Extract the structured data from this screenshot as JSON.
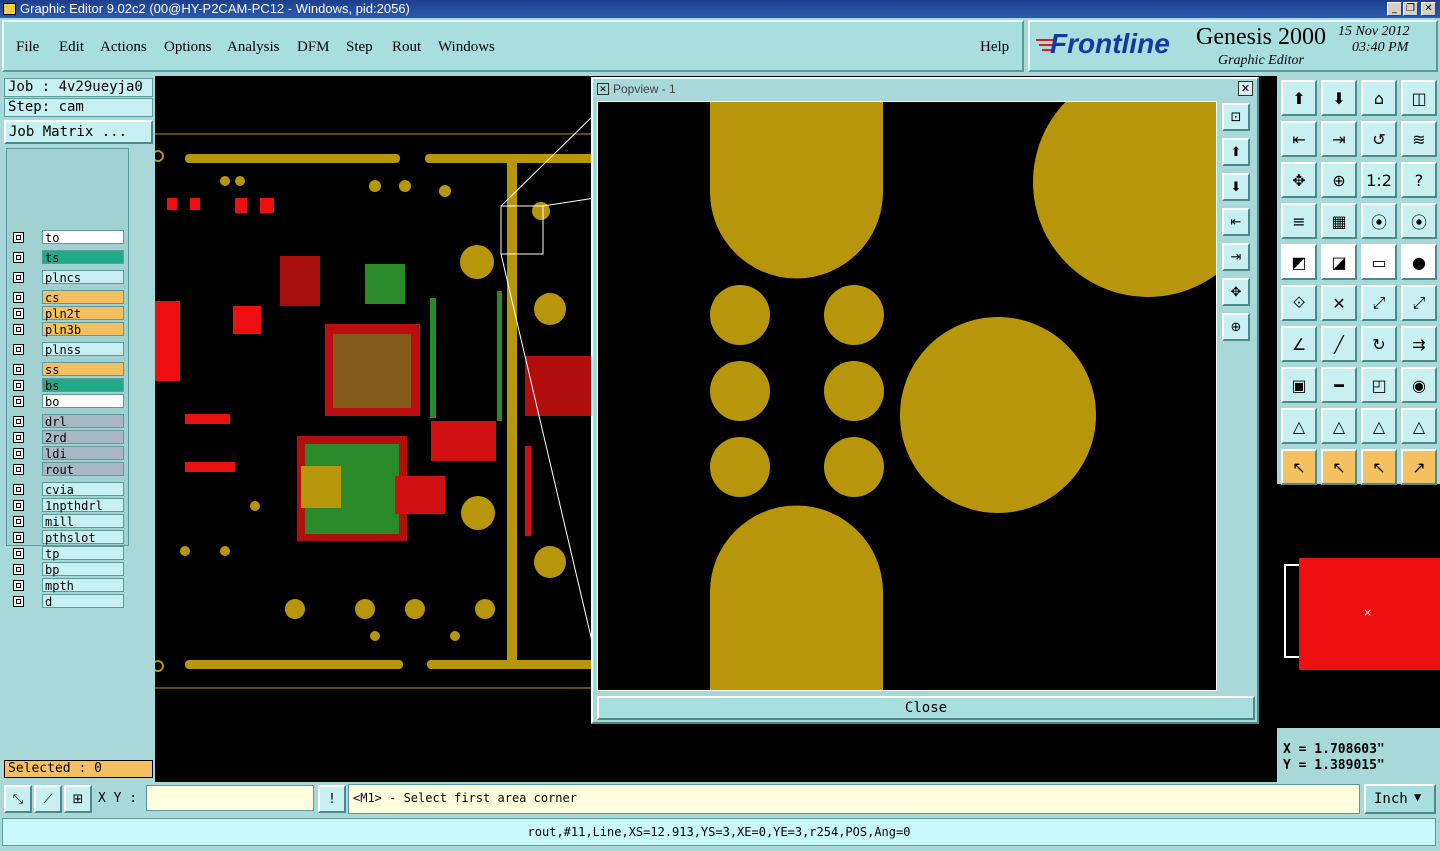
{
  "window": {
    "title": "Graphic Editor 9.02c2 (00@HY-P2CAM-PC12 - Windows, pid:2056)"
  },
  "menu": {
    "items": [
      "File",
      "Edit",
      "Actions",
      "Options",
      "Analysis",
      "DFM",
      "Step",
      "Rout",
      "Windows"
    ],
    "help": "Help"
  },
  "brand": {
    "logo": "Frontline",
    "product": "Genesis 2000",
    "subtitle": "Graphic Editor",
    "date": "15 Nov 2012",
    "time": "03:40 PM"
  },
  "job": {
    "job": "Job : 4v29ueyja0",
    "step": "Step: cam",
    "matrix_button": "Job Matrix ..."
  },
  "layers": [
    {
      "name": "to",
      "color": "#ffffff"
    },
    {
      "name": "ts",
      "color": "#22aa88"
    },
    {
      "name": "plncs",
      "color": "#c8f0f0"
    },
    {
      "name": "cs",
      "color": "#f5c060"
    },
    {
      "name": "pln2t",
      "color": "#f5c060"
    },
    {
      "name": "pln3b",
      "color": "#f5c060"
    },
    {
      "name": "plnss",
      "color": "#c8f0f0"
    },
    {
      "name": "ss",
      "color": "#f5c060"
    },
    {
      "name": "bs",
      "color": "#22aa88"
    },
    {
      "name": "bo",
      "color": "#ffffff"
    },
    {
      "name": "drl",
      "color": "#a8b8c0"
    },
    {
      "name": "2rd",
      "color": "#a8b8c0"
    },
    {
      "name": "ldi",
      "color": "#a8b8c0"
    },
    {
      "name": "rout",
      "color": "#a8b8c0"
    },
    {
      "name": "cvia",
      "color": "#c8f0f0"
    },
    {
      "name": "1npthdrl",
      "color": "#c8f0f0"
    },
    {
      "name": "mill",
      "color": "#c8f0f0"
    },
    {
      "name": "pthslot",
      "color": "#c8f0f0"
    },
    {
      "name": "tp",
      "color": "#c8f0f0"
    },
    {
      "name": "bp",
      "color": "#c8f0f0"
    },
    {
      "name": "mpth",
      "color": "#c8f0f0"
    },
    {
      "name": "d",
      "color": "#c8f0f0"
    }
  ],
  "selected": "Selected : 0",
  "popview": {
    "title": "Popview - 1",
    "close_label": "Close"
  },
  "coords": {
    "x": "X = 1.708603\"",
    "y": "Y = 1.389015\""
  },
  "bottom": {
    "xy_label": "X Y :",
    "xy_value": "",
    "message": "<M1> - Select first area corner",
    "unit": "Inch",
    "status": "rout,#11,Line,XS=12.913,YS=3,XE=0,YE=3,r254,POS,Ang=0"
  },
  "colors": {
    "pad": "#b8960c",
    "red": "#ee1010",
    "green": "#2a8a2a",
    "panel": "#a8d8d8"
  }
}
